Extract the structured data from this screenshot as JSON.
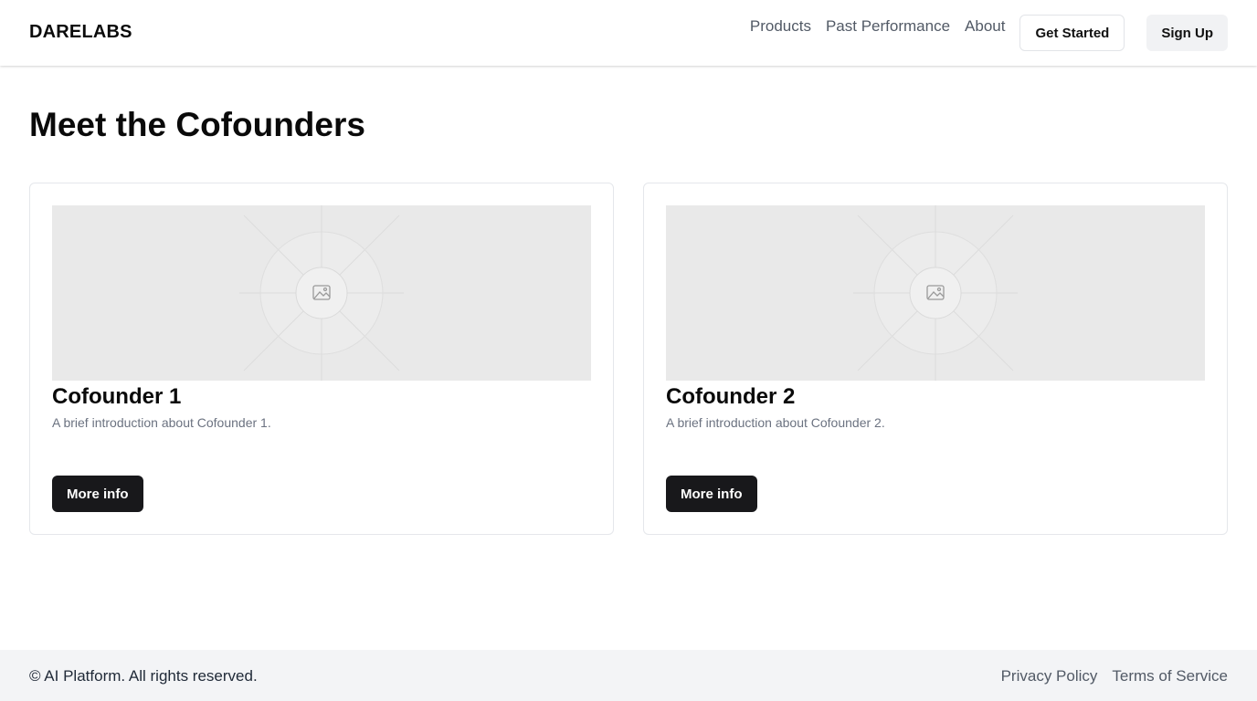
{
  "header": {
    "brand": "DARELABS",
    "nav": {
      "products": "Products",
      "past_performance": "Past Performance",
      "about": "About"
    },
    "get_started_label": "Get Started",
    "sign_up_label": "Sign Up"
  },
  "main": {
    "title": "Meet the Cofounders",
    "cards": [
      {
        "title": "Cofounder 1",
        "description": "A brief introduction about Cofounder 1.",
        "button_label": "More info",
        "image_icon": "image-placeholder-icon"
      },
      {
        "title": "Cofounder 2",
        "description": "A brief introduction about Cofounder 2.",
        "button_label": "More info",
        "image_icon": "image-placeholder-icon"
      }
    ]
  },
  "footer": {
    "copyright": "© AI Platform. All rights reserved.",
    "privacy_label": "Privacy Policy",
    "terms_label": "Terms of Service"
  },
  "colors": {
    "primary_button": "#18181b",
    "footer_bg": "#f3f4f6",
    "placeholder_bg": "#e9e9e9"
  }
}
